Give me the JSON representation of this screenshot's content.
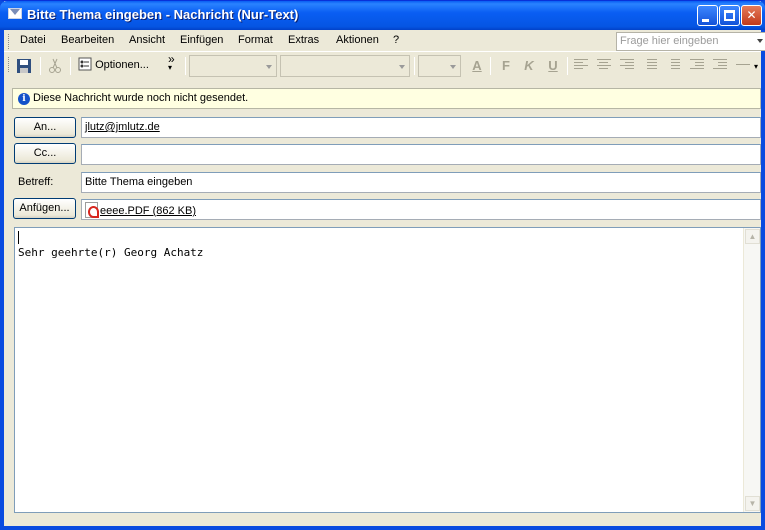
{
  "window": {
    "title": "Bitte Thema eingeben - Nachricht (Nur-Text)"
  },
  "menu": {
    "items": [
      {
        "label": "Datei"
      },
      {
        "label": "Bearbeiten"
      },
      {
        "label": "Ansicht"
      },
      {
        "label": "Einfügen"
      },
      {
        "label": "Format"
      },
      {
        "label": "Extras"
      },
      {
        "label": "Aktionen"
      },
      {
        "label": "?"
      }
    ],
    "help_placeholder": "Frage hier eingeben"
  },
  "toolbar": {
    "options_label": "Optionen...",
    "overflow": "»",
    "format_icons": {
      "bold": "F",
      "italic": "K",
      "underline": "U"
    }
  },
  "info_bar": {
    "text": "Diese Nachricht wurde noch nicht gesendet."
  },
  "header": {
    "to_button": "An...",
    "to_value": "jlutz@jmlutz.de",
    "cc_button": "Cc...",
    "cc_value": "",
    "subject_label": "Betreff:",
    "subject_value": "Bitte Thema eingeben",
    "attach_button": "Anfügen...",
    "attachment": "eeee.PDF (862 KB)"
  },
  "body": {
    "text": "Sehr geehrte(r) Georg Achatz"
  },
  "icons": {
    "window": "mail-envelope-icon",
    "save": "save-disk-icon",
    "cut": "scissors-icon",
    "options": "options-icon",
    "info": "info-icon",
    "attachment": "pdf-file-icon"
  }
}
